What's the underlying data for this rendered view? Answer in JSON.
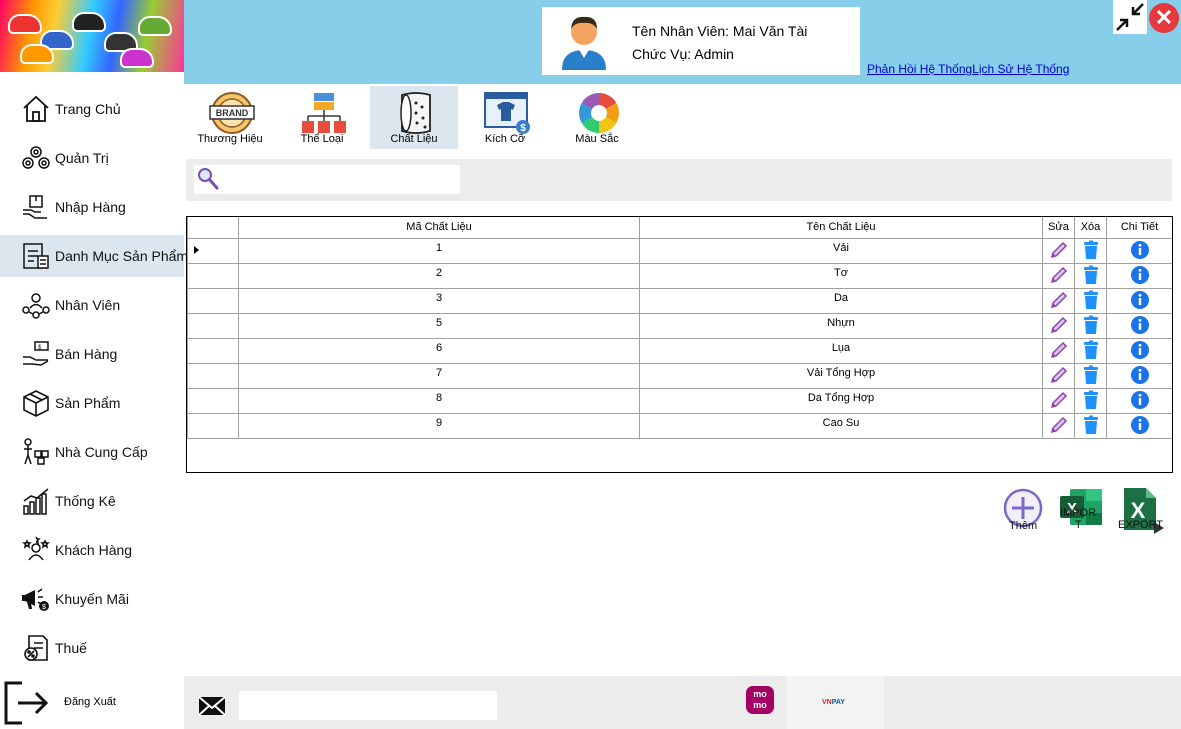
{
  "header": {
    "employee_name": "Tên Nhân Viên: Mai Văn Tài",
    "employee_role": "Chức Vụ: Admin",
    "feedback_link": "Phản Hồi Hệ Thống",
    "history_link": "Lịch Sử Hệ Thống"
  },
  "sidebar": {
    "items": [
      {
        "label": "Trang Chủ",
        "icon": "home-icon"
      },
      {
        "label": "Quản Trị",
        "icon": "admin-gears-icon"
      },
      {
        "label": "Nhập Hàng",
        "icon": "import-goods-icon"
      },
      {
        "label": "Danh Mục Sản Phẩm",
        "icon": "product-catalog-icon",
        "active": true
      },
      {
        "label": "Nhân Viên",
        "icon": "employees-icon"
      },
      {
        "label": "Bán Hàng",
        "icon": "sales-icon"
      },
      {
        "label": "Sản Phẩm",
        "icon": "product-box-icon"
      },
      {
        "label": "Nhà Cung Cấp",
        "icon": "supplier-icon"
      },
      {
        "label": "Thống Kê",
        "icon": "statistics-chart-icon"
      },
      {
        "label": "Khách Hàng",
        "icon": "customers-icon"
      },
      {
        "label": "Khuyến Mãi",
        "icon": "promotion-megaphone-icon"
      },
      {
        "label": "Thuế",
        "icon": "tax-document-icon"
      }
    ],
    "logout_label": "Đăng Xuất"
  },
  "category_tabs": [
    {
      "label": "Thương Hiệu",
      "icon": "brand-badge-icon"
    },
    {
      "label": "Thể Loại",
      "icon": "category-tree-icon"
    },
    {
      "label": "Chất Liệu",
      "icon": "fabric-roll-icon",
      "active": true
    },
    {
      "label": "Kích Cỡ",
      "icon": "size-shirt-icon"
    },
    {
      "label": "Màu Sắc",
      "icon": "color-wheel-icon"
    }
  ],
  "search": {
    "value": ""
  },
  "table": {
    "columns": [
      "Mã Chất Liệu",
      "Tên Chất Liệu",
      "Sửa",
      "Xóa",
      "Chi Tiết"
    ],
    "rows": [
      {
        "id": "1",
        "name": "Vải"
      },
      {
        "id": "2",
        "name": "Tơ"
      },
      {
        "id": "3",
        "name": "Da"
      },
      {
        "id": "5",
        "name": "Nhựn"
      },
      {
        "id": "6",
        "name": "Lụa"
      },
      {
        "id": "7",
        "name": "Vải Tổng Hợp"
      },
      {
        "id": "8",
        "name": "Da Tổng Hợp"
      },
      {
        "id": "9",
        "name": "Cao Su"
      }
    ]
  },
  "actions": {
    "add_label": "Thêm",
    "import_label_1": "IMPOR",
    "import_label_2": "T",
    "export_label": "EXPORT"
  },
  "footer": {
    "message_value": "",
    "momo_label_1": "mo",
    "momo_label_2": "mo",
    "vnpay_label_1": "VN",
    "vnpay_label_2": "PAY"
  },
  "colors": {
    "header_bg": "#87ceeb",
    "active_bg": "#dce6ef",
    "close_red": "#e6393d",
    "info_blue": "#1a73e8",
    "trash_blue": "#1e90ff",
    "edit_purple": "#9b59b6",
    "excel_green": "#1d7044",
    "momo_pink": "#a50064"
  }
}
